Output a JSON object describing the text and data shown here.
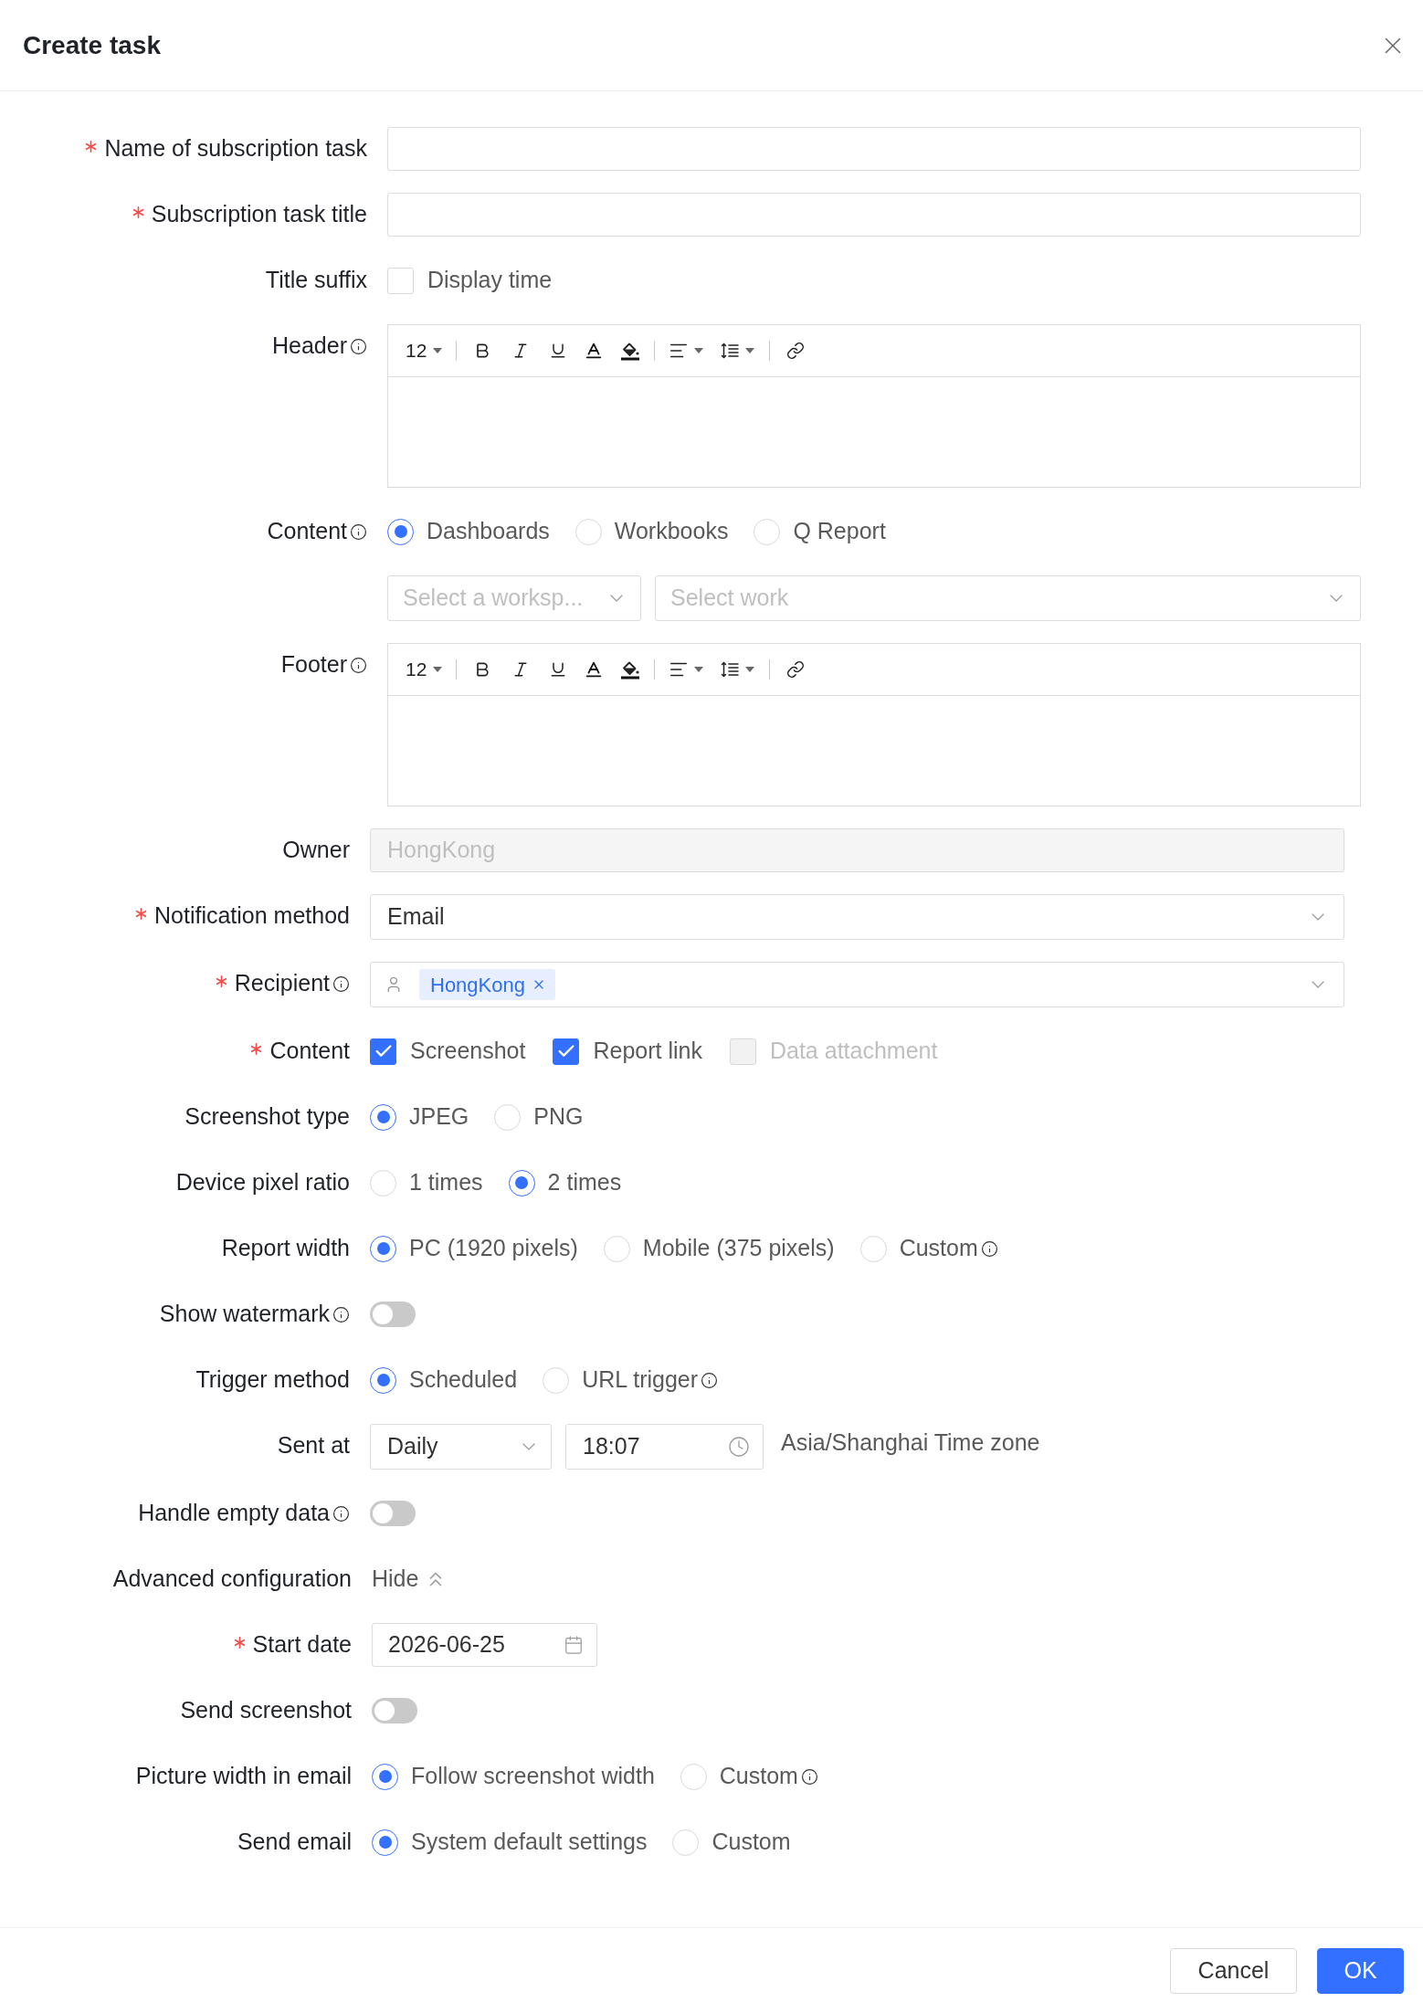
{
  "dialog": {
    "title": "Create task"
  },
  "sections": [
    {
      "fields": [
        {
          "kind": "text",
          "label": "Name of subscription task",
          "required": true,
          "info": false
        },
        {
          "kind": "text",
          "label": "Subscription task title",
          "required": true,
          "info": false
        },
        {
          "kind": "checkbox",
          "label": "Title suffix",
          "required": false,
          "info": false,
          "items": [
            {
              "label": "Display time",
              "checked": false,
              "disabled": false
            }
          ]
        },
        {
          "kind": "editor",
          "label": "Header",
          "required": false,
          "info": true,
          "font_size": "12"
        },
        {
          "kind": "radio",
          "label": "Content",
          "required": false,
          "info": true,
          "options": [
            {
              "label": "Dashboards",
              "selected": true,
              "info": false
            },
            {
              "label": "Workbooks",
              "selected": false,
              "info": false
            },
            {
              "label": "Q Report",
              "selected": false,
              "info": false
            }
          ]
        },
        {
          "kind": "select_pair",
          "required": false,
          "info": false,
          "selects": [
            {
              "placeholder": "Select a worksp..."
            },
            {
              "placeholder": "Select work"
            }
          ]
        },
        {
          "kind": "editor",
          "label": "Footer",
          "required": false,
          "info": true,
          "font_size": "12"
        }
      ]
    },
    {
      "fields": [
        {
          "kind": "text",
          "label": "Owner",
          "required": false,
          "info": false,
          "disabled": true,
          "value": "HongKong"
        },
        {
          "kind": "select",
          "label": "Notification method",
          "required": true,
          "info": false,
          "value": "Email"
        },
        {
          "kind": "tags",
          "label": "Recipient",
          "required": true,
          "info": true,
          "tags": [
            {
              "label": "HongKong"
            }
          ]
        },
        {
          "kind": "checkbox",
          "label": "Content",
          "required": true,
          "info": false,
          "items": [
            {
              "label": "Screenshot",
              "checked": true,
              "disabled": false
            },
            {
              "label": "Report link",
              "checked": true,
              "disabled": false
            },
            {
              "label": "Data attachment",
              "checked": false,
              "disabled": true
            }
          ]
        },
        {
          "kind": "radio",
          "label": "Screenshot type",
          "required": false,
          "info": false,
          "options": [
            {
              "label": "JPEG",
              "selected": true,
              "info": false
            },
            {
              "label": "PNG",
              "selected": false,
              "info": false
            }
          ]
        },
        {
          "kind": "radio",
          "label": "Device pixel ratio",
          "required": false,
          "info": false,
          "options": [
            {
              "label": "1 times",
              "selected": false,
              "info": false
            },
            {
              "label": "2 times",
              "selected": true,
              "info": false
            }
          ]
        },
        {
          "kind": "radio",
          "label": "Report width",
          "required": false,
          "info": false,
          "options": [
            {
              "label": "PC (1920 pixels)",
              "selected": true,
              "info": false
            },
            {
              "label": "Mobile (375 pixels)",
              "selected": false,
              "info": false
            },
            {
              "label": "Custom",
              "selected": false,
              "info": true
            }
          ]
        },
        {
          "kind": "toggle",
          "label": "Show watermark",
          "required": false,
          "info": true,
          "on": false
        },
        {
          "kind": "radio",
          "label": "Trigger method",
          "required": false,
          "info": false,
          "options": [
            {
              "label": "Scheduled",
              "selected": true,
              "info": false
            },
            {
              "label": "URL trigger",
              "selected": false,
              "info": true
            }
          ]
        },
        {
          "kind": "schedule",
          "label": "Sent at",
          "required": false,
          "info": false,
          "frequency": "Daily",
          "time": "18:07",
          "timezone": "Asia/Shanghai Time zone"
        },
        {
          "kind": "toggle",
          "label": "Handle empty data",
          "required": false,
          "info": true,
          "on": false
        }
      ]
    },
    {
      "fields": [
        {
          "kind": "disclosure",
          "label": "Advanced configuration",
          "required": false,
          "info": false,
          "link": "Hide",
          "expanded": true
        },
        {
          "kind": "date",
          "label": "Start date",
          "required": true,
          "info": false,
          "value": "2026-06-25"
        },
        {
          "kind": "toggle",
          "label": "Send screenshot",
          "required": false,
          "info": false,
          "on": false
        },
        {
          "kind": "radio",
          "label": "Picture width in email",
          "required": false,
          "info": false,
          "options": [
            {
              "label": "Follow screenshot width",
              "selected": true,
              "info": false
            },
            {
              "label": "Custom",
              "selected": false,
              "info": true
            }
          ]
        },
        {
          "kind": "radio",
          "label": "Send email",
          "required": false,
          "info": false,
          "options": [
            {
              "label": "System default settings",
              "selected": true,
              "info": false
            },
            {
              "label": "Custom",
              "selected": false,
              "info": false
            }
          ]
        }
      ]
    }
  ],
  "buttons": [
    {
      "label": "Cancel",
      "kind": "secondary"
    },
    {
      "label": "OK",
      "kind": "primary"
    }
  ]
}
